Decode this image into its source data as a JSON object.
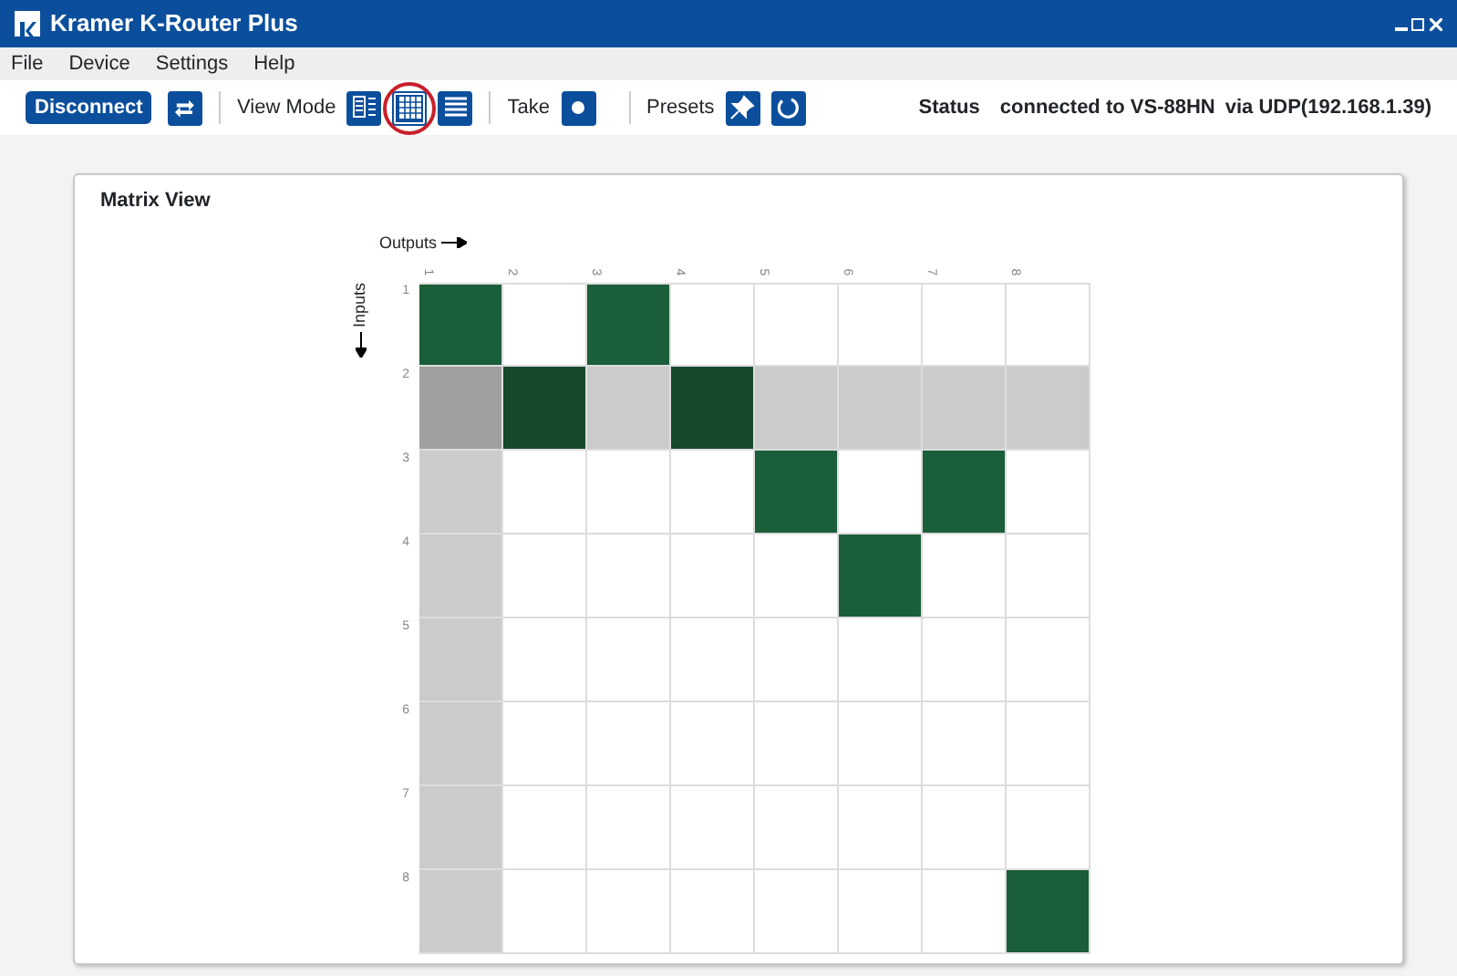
{
  "window": {
    "title": "Kramer K-Router Plus"
  },
  "menu": [
    "File",
    "Device",
    "Settings",
    "Help"
  ],
  "toolbar": {
    "disconnect": "Disconnect",
    "view_mode_label": "View Mode",
    "view_modes": [
      {
        "kind": "list",
        "selected": false
      },
      {
        "kind": "grid",
        "selected": true
      },
      {
        "kind": "rows",
        "selected": false
      }
    ],
    "take_label": "Take",
    "presets_label": "Presets"
  },
  "status": {
    "label": "Status",
    "device": "connected to VS-88HN",
    "link": "via UDP(192.168.1.39)"
  },
  "matrix": {
    "title": "Matrix View",
    "outputs_label": "Outputs",
    "inputs_label": "Inputs",
    "columns": [
      {
        "label": "1",
        "highlighted": true
      },
      {
        "label": "2",
        "highlighted": false
      },
      {
        "label": "3",
        "highlighted": false
      },
      {
        "label": "4",
        "highlighted": false
      },
      {
        "label": "5",
        "highlighted": false
      },
      {
        "label": "6",
        "highlighted": false
      },
      {
        "label": "7",
        "highlighted": false
      },
      {
        "label": "8",
        "highlighted": false
      }
    ],
    "rows": [
      {
        "label": "1",
        "highlighted": false,
        "connected": [
          true,
          false,
          true,
          false,
          false,
          false,
          false,
          false
        ]
      },
      {
        "label": "2",
        "highlighted": true,
        "connected": [
          false,
          true,
          false,
          true,
          false,
          false,
          false,
          false
        ]
      },
      {
        "label": "3",
        "highlighted": false,
        "connected": [
          false,
          false,
          false,
          false,
          true,
          false,
          true,
          false
        ]
      },
      {
        "label": "4",
        "highlighted": false,
        "connected": [
          false,
          false,
          false,
          false,
          false,
          true,
          false,
          false
        ]
      },
      {
        "label": "5",
        "highlighted": false,
        "connected": [
          false,
          false,
          false,
          false,
          false,
          false,
          false,
          false
        ]
      },
      {
        "label": "6",
        "highlighted": false,
        "connected": [
          false,
          false,
          false,
          false,
          false,
          false,
          false,
          false
        ]
      },
      {
        "label": "7",
        "highlighted": false,
        "connected": [
          false,
          false,
          false,
          false,
          false,
          false,
          false,
          false
        ]
      },
      {
        "label": "8",
        "highlighted": false,
        "connected": [
          false,
          false,
          false,
          false,
          false,
          false,
          false,
          true
        ]
      }
    ]
  }
}
